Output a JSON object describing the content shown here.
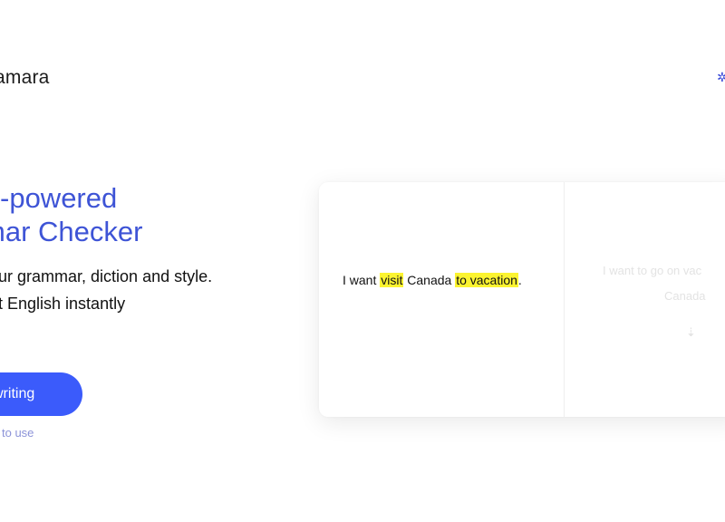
{
  "header": {
    "logo_text": "amara",
    "language_icon": "flag-icon"
  },
  "hero": {
    "title_line1": "-powered",
    "title_line2": "mar Checker",
    "subtitle_line1": "our grammar, diction and style.",
    "subtitle_line2": "nt English instantly",
    "cta_label": "writing",
    "cta_note": "to use"
  },
  "demo": {
    "input_segments": [
      "I want ",
      "visit",
      " Canada ",
      "to vacation",
      "."
    ],
    "highlighted_segments": [
      1,
      3
    ],
    "output_line1": "I want to go on vac",
    "output_line2": "Canada",
    "output_icon": "arrow-down-icon"
  },
  "colors": {
    "accent": "#3b5bfb",
    "title": "#3e54d6",
    "highlight": "#fcf430",
    "note": "#8c93d8"
  }
}
